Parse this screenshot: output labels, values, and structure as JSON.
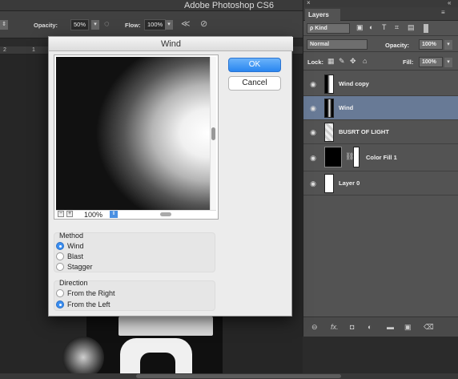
{
  "app": {
    "title": "Adobe Photoshop CS6"
  },
  "options_bar": {
    "opacity_label": "Opacity:",
    "opacity_value": "50%",
    "flow_label": "Flow:",
    "flow_value": "100%",
    "dropdown_arrow": "▾",
    "stepper_arrows": "⇕"
  },
  "ruler": {
    "marks": [
      "2",
      "1"
    ]
  },
  "dialog": {
    "title": "Wind",
    "ok_label": "OK",
    "cancel_label": "Cancel",
    "zoom_out_label": "−",
    "zoom_in_label": "+",
    "zoom_value": "100%",
    "method": {
      "title": "Method",
      "options": [
        {
          "label": "Wind",
          "selected": true
        },
        {
          "label": "Blast",
          "selected": false
        },
        {
          "label": "Stagger",
          "selected": false
        }
      ]
    },
    "direction": {
      "title": "Direction",
      "options": [
        {
          "label": "From the Right",
          "selected": false
        },
        {
          "label": "From the Left",
          "selected": true
        }
      ]
    }
  },
  "layers_panel": {
    "tab_label": "Layers",
    "close_glyph": "×",
    "collapse_glyph": "«",
    "menu_glyph": "≡",
    "kind_label": "ρ Kind",
    "blend_mode": "Normal",
    "opacity_label": "Opacity:",
    "opacity_value": "100%",
    "lock_label": "Lock:",
    "fill_label": "Fill:",
    "fill_value": "100%",
    "layers": [
      {
        "name": "Wind copy",
        "selected": false
      },
      {
        "name": "Wind",
        "selected": true
      },
      {
        "name": "BUSRT OF LIGHT",
        "selected": false
      },
      {
        "name": "Color Fill 1",
        "selected": false
      },
      {
        "name": "Layer 0",
        "selected": false
      }
    ],
    "bottom_icons": [
      "link-icon",
      "fx-icon",
      "mask-icon",
      "adjustment-icon",
      "folder-icon",
      "new-layer-icon",
      "trash-icon"
    ]
  }
}
